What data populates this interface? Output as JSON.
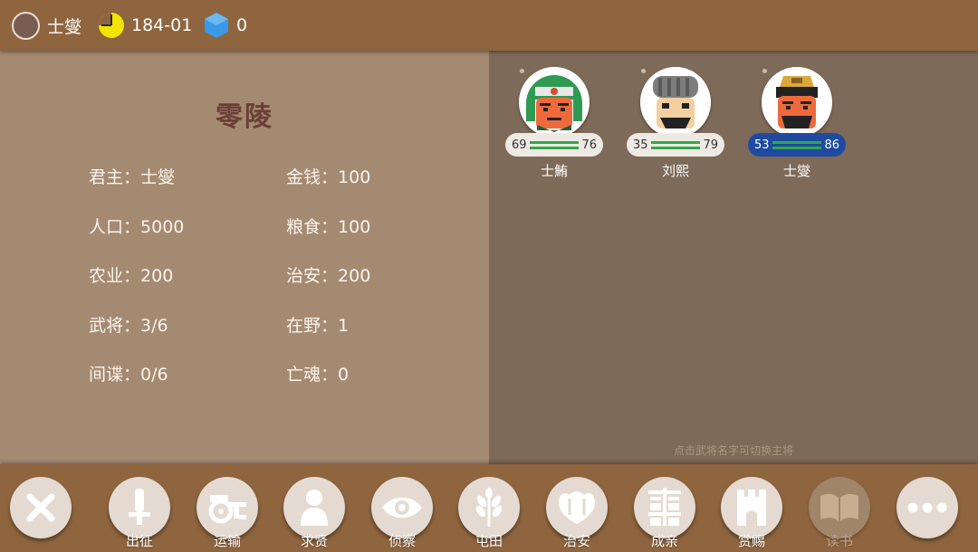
{
  "topbar": {
    "lord_name": "士燮",
    "date": "184-01",
    "gems": "0"
  },
  "city": {
    "title": "零陵",
    "stats": [
      {
        "key": "君主",
        "value": "士燮"
      },
      {
        "key": "金钱",
        "value": "100"
      },
      {
        "key": "人口",
        "value": "5000"
      },
      {
        "key": "粮食",
        "value": "100"
      },
      {
        "key": "农业",
        "value": "200"
      },
      {
        "key": "治安",
        "value": "200"
      },
      {
        "key": "武将",
        "value": "3/6"
      },
      {
        "key": "在野",
        "value": "1"
      },
      {
        "key": "间谍",
        "value": "0/6"
      },
      {
        "key": "亡魂",
        "value": "0"
      }
    ]
  },
  "generals": [
    {
      "name": "士鮪",
      "stat_left": "69",
      "stat_right": "76",
      "selected": false
    },
    {
      "name": "刘熙",
      "stat_left": "35",
      "stat_right": "79",
      "selected": false
    },
    {
      "name": "士燮",
      "stat_left": "53",
      "stat_right": "86",
      "selected": true
    }
  ],
  "hint": "点击武将名字可切换主将",
  "toolbar": {
    "close_icon": "close-icon",
    "items": [
      {
        "label": "出征",
        "icon": "sword-icon"
      },
      {
        "label": "运输",
        "icon": "cart-icon"
      },
      {
        "label": "求贤",
        "icon": "person-icon"
      },
      {
        "label": "侦察",
        "icon": "eye-icon"
      },
      {
        "label": "屯田",
        "icon": "wheat-icon"
      },
      {
        "label": "治安",
        "icon": "shield-icon"
      },
      {
        "label": "成亲",
        "icon": "double-happiness-icon"
      },
      {
        "label": "赏赐",
        "icon": "castle-icon"
      },
      {
        "label": "读书",
        "icon": "book-icon",
        "disabled": true
      }
    ],
    "more_icon": "more-icon"
  },
  "colors": {
    "topbar": "#8f653f",
    "left_panel": "#a58a72",
    "right_panel": "#7e6a58",
    "title": "#6b3f37",
    "selected_pill": "#1f4aa2",
    "stat_bar": "#2fa84a"
  }
}
